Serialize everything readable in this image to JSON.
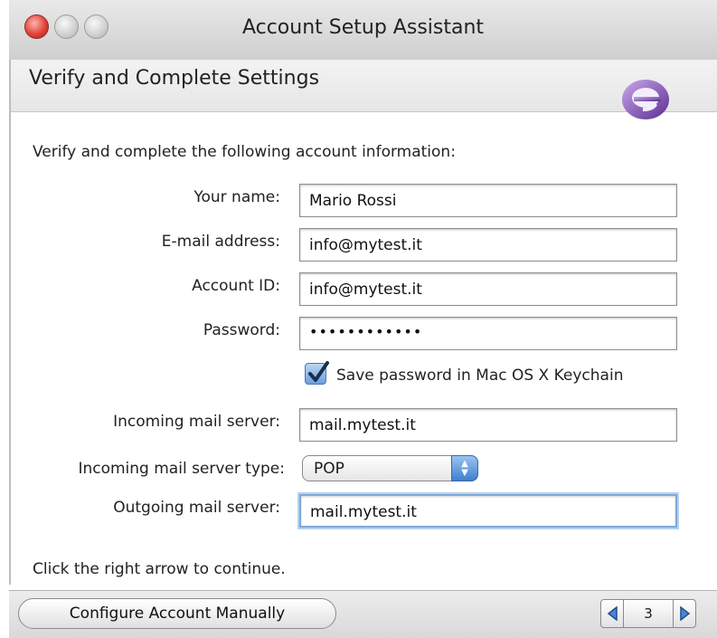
{
  "window": {
    "title": "Account Setup Assistant"
  },
  "header": {
    "title": "Verify and Complete Settings",
    "logo_icon": "entourage-logo-icon"
  },
  "form": {
    "intro": "Verify and complete the following account information:",
    "your_name": {
      "label": "Your name:",
      "value": "Mario Rossi"
    },
    "email": {
      "label": "E-mail address:",
      "value": "info@mytest.it"
    },
    "account_id": {
      "label": "Account ID:",
      "value": "info@mytest.it"
    },
    "password": {
      "label": "Password:",
      "value": "••••••••••••"
    },
    "save_password": {
      "label": "Save password in Mac OS X Keychain",
      "checked": true
    },
    "incoming_server": {
      "label": "Incoming mail server:",
      "value": "mail.mytest.it"
    },
    "incoming_type": {
      "label": "Incoming mail server type:",
      "value": "POP"
    },
    "outgoing_server": {
      "label": "Outgoing mail server:",
      "value": "mail.mytest.it"
    }
  },
  "footer": {
    "hint": "Click the right arrow to continue.",
    "configure_button": "Configure Account Manually",
    "page_number": "3"
  },
  "colors": {
    "close": "#e0443a",
    "accent": "#3e7fcf",
    "focus_ring": "#7ea9d6",
    "logo": "#7a4bb0"
  }
}
